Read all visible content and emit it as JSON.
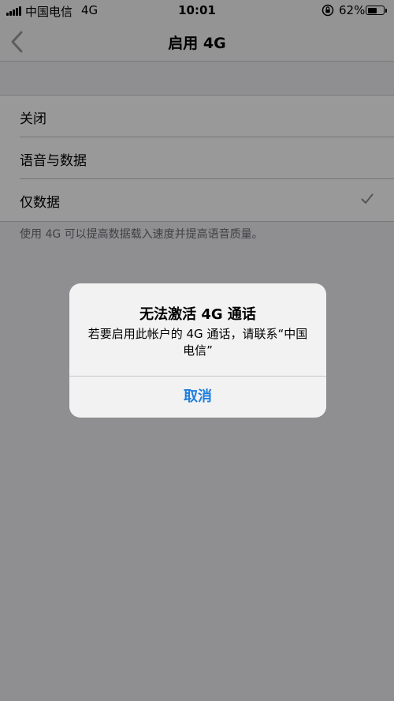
{
  "status_bar": {
    "carrier": "中国电信",
    "network": "4G",
    "time": "10:01",
    "battery_percent": "62%",
    "battery_level": 0.62
  },
  "nav": {
    "title": "启用 4G",
    "back_icon": "chevron-left-icon"
  },
  "options": [
    {
      "label": "关闭",
      "selected": false
    },
    {
      "label": "语音与数据",
      "selected": false
    },
    {
      "label": "仅数据",
      "selected": true
    }
  ],
  "footnote": "使用 4G 可以提高数据载入速度并提高语音质量。",
  "alert": {
    "title": "无法激活 4G 通话",
    "message": "若要启用此帐户的 4G 通话，请联系“中国电信”",
    "cancel_label": "取消"
  },
  "colors": {
    "accent": "#1f7ee0",
    "checkmark": "#8e8e93"
  }
}
